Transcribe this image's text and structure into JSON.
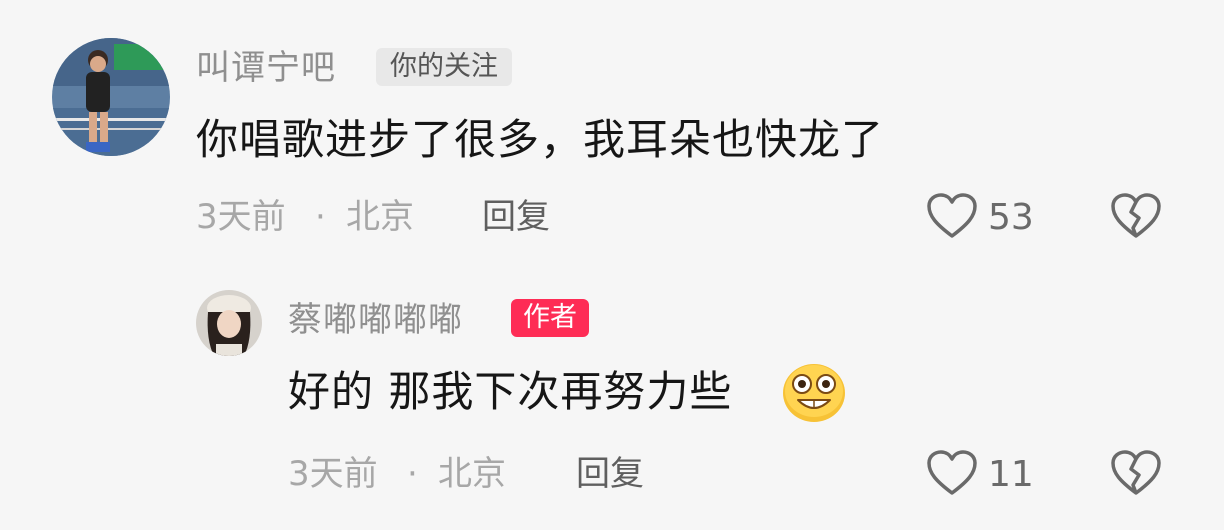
{
  "comments": [
    {
      "username": "叫谭宁吧",
      "badge": "你的关注",
      "text": "你唱歌进步了很多，我耳朵也快龙了",
      "time": "3天前",
      "location": "北京",
      "separator": "·",
      "reply_label": "回复",
      "like_count": "53",
      "avatar_icon": "avatar-badminton-player"
    },
    {
      "username": "蔡嘟嘟嘟嘟",
      "badge": "作者",
      "text": "好的 那我下次再努力些",
      "emoji": "grinning-emoji",
      "time": "3天前",
      "location": "北京",
      "separator": "·",
      "reply_label": "回复",
      "like_count": "11",
      "avatar_icon": "avatar-woman-hat"
    }
  ],
  "colors": {
    "author_badge": "#fe2c55",
    "follow_badge": "#e8e8e8",
    "username": "#8f8f8f",
    "text": "#161616"
  }
}
